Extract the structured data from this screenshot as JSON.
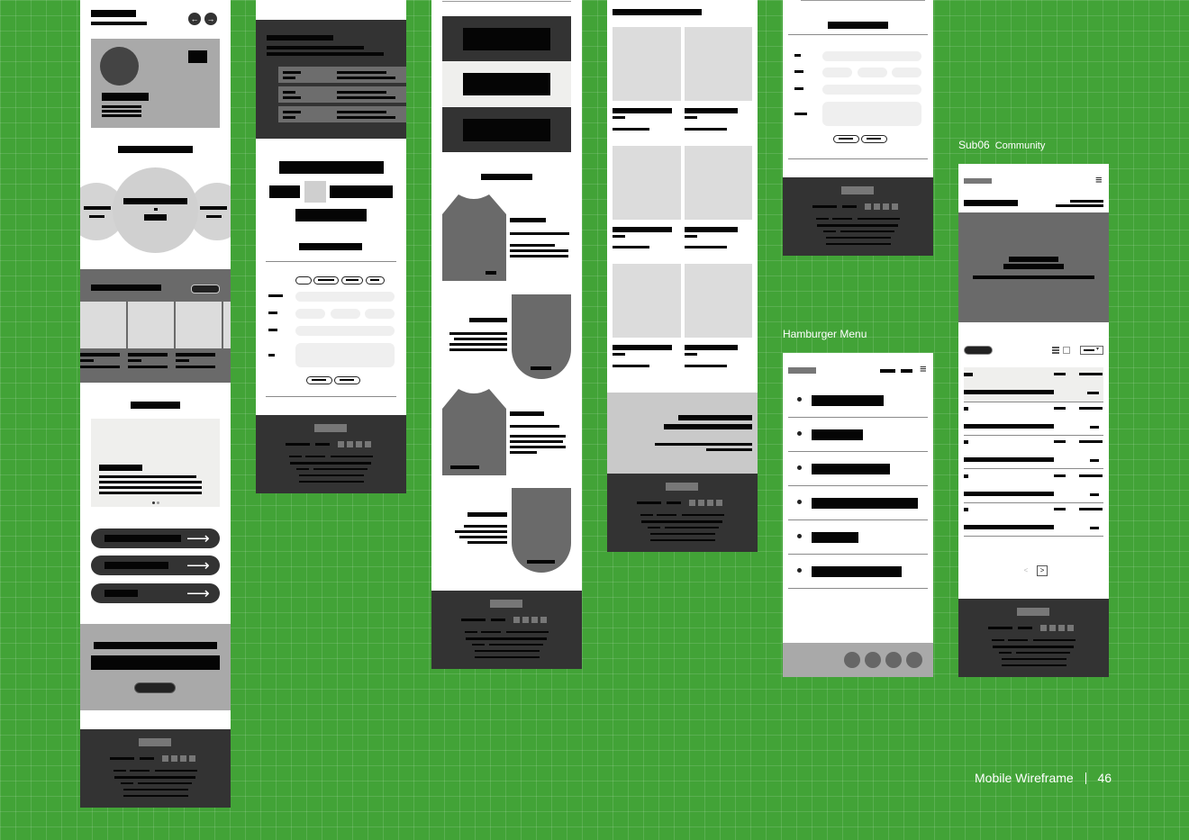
{
  "captions": {
    "community": {
      "title": "Sub06",
      "subtitle": "Community"
    },
    "hamburger": {
      "title": "Hamburger Menu"
    }
  },
  "footer": {
    "label": "Mobile Wireframe",
    "page": "46"
  },
  "icons": {
    "prev": "←",
    "next": "→",
    "arrow": "⟶",
    "menu": "≡",
    "page_next": ">",
    "page_prev": "<",
    "dropdown": "▾"
  },
  "colors": {
    "background": "#42a337",
    "wire_black": "#050505",
    "wire_dark": "#333333",
    "wire_mid": "#6a6a6a",
    "wire_light": "#dcdcdc"
  }
}
